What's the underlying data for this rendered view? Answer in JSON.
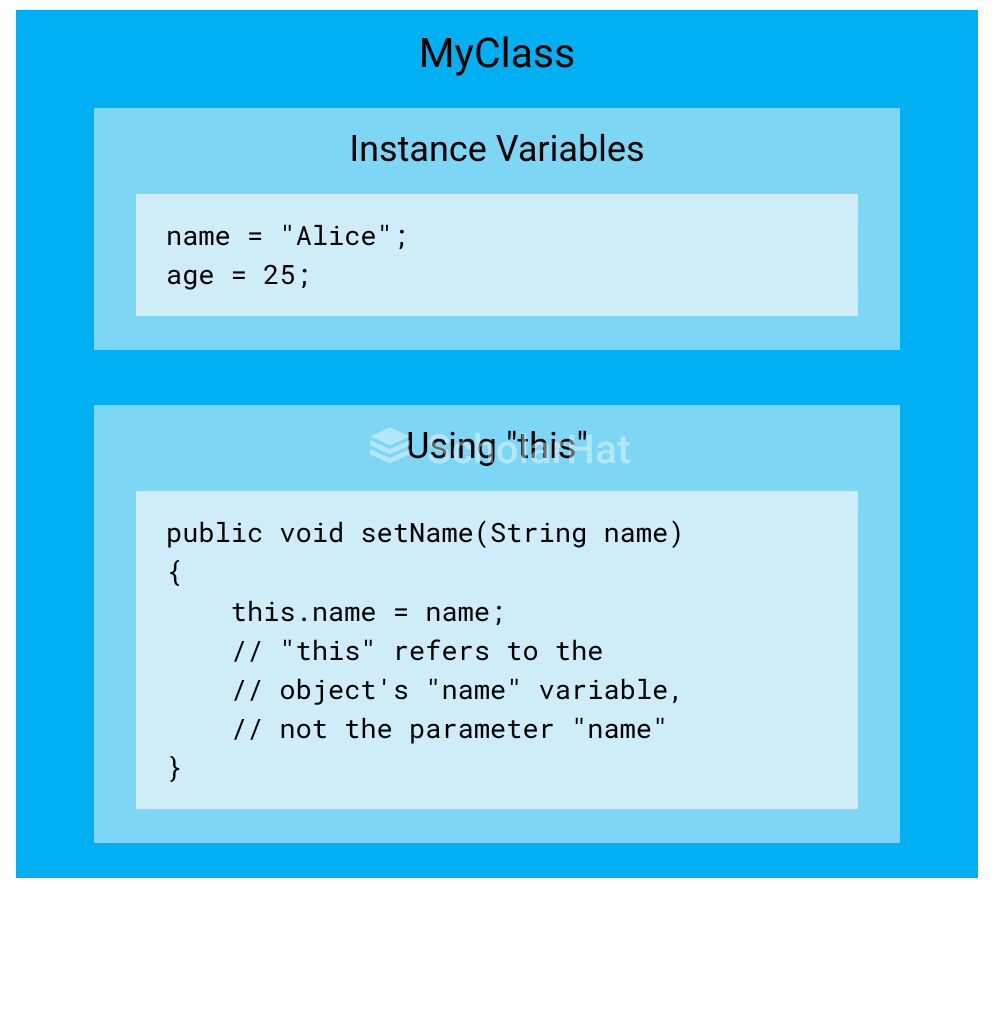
{
  "mainTitle": "MyClass",
  "sections": {
    "instanceVars": {
      "title": "Instance Variables",
      "code": "name = \"Alice\";\nage = 25;"
    },
    "usingThis": {
      "title": "Using \"this\"",
      "code": "public void setName(String name)\n{\n    this.name = name;\n    // \"this\" refers to the\n    // object's \"name\" variable,\n    // not the parameter \"name\"\n}"
    }
  },
  "watermark": {
    "text": "ScholarHat"
  }
}
